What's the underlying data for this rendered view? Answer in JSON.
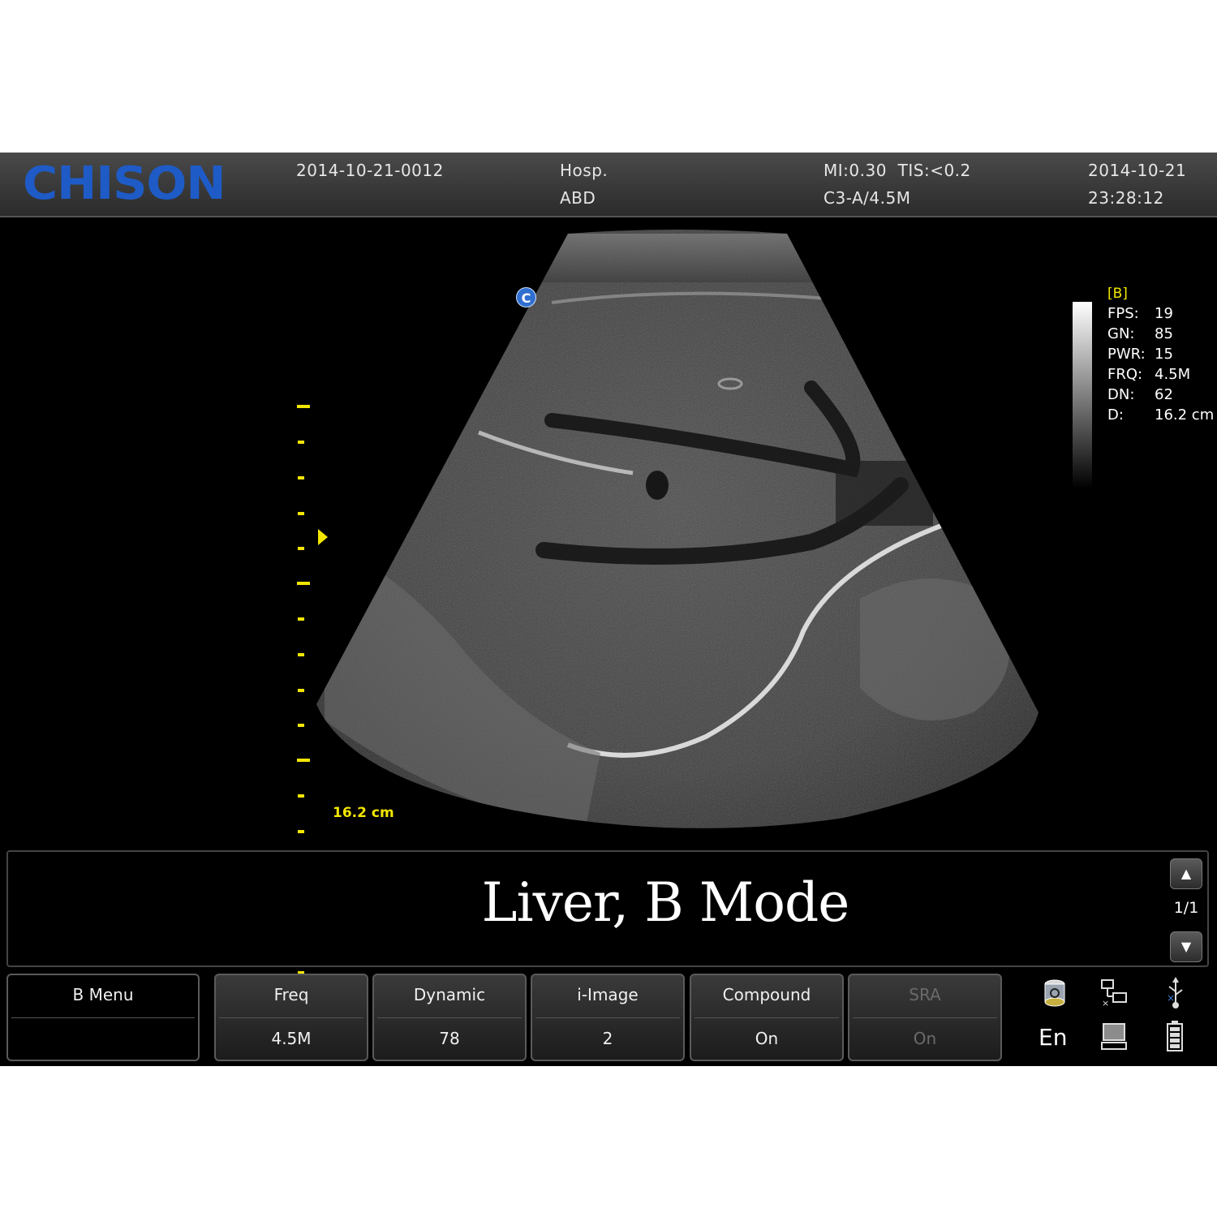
{
  "header": {
    "logo": "CHISON",
    "patient_id": "2014-10-21-0012",
    "hospital": "Hosp.",
    "exam": "ABD",
    "mi_tis": "MI:0.30  TIS:<0.2",
    "probe": "C3-A/4.5M",
    "date": "2014-10-21",
    "time": "23:28:12"
  },
  "image": {
    "orientation_marker": "C",
    "depth_label": "16.2 cm",
    "mode": "[B]",
    "params": [
      {
        "key": "FPS:",
        "value": "19"
      },
      {
        "key": "GN:",
        "value": "85"
      },
      {
        "key": "PWR:",
        "value": "15"
      },
      {
        "key": "FRQ:",
        "value": "4.5M"
      },
      {
        "key": "DN:",
        "value": "62"
      },
      {
        "key": "D:",
        "value": "16.2 cm"
      }
    ]
  },
  "comment": {
    "text": "Liver, B Mode",
    "page": "1/1",
    "up_icon": "triangle-up-icon",
    "down_icon": "triangle-down-icon"
  },
  "menu": {
    "label": "B Menu",
    "buttons": [
      {
        "label": "Freq",
        "value": "4.5M",
        "enabled": true
      },
      {
        "label": "Dynamic",
        "value": "78",
        "enabled": true
      },
      {
        "label": "i-Image",
        "value": "2",
        "enabled": true
      },
      {
        "label": "Compound",
        "value": "On",
        "enabled": true
      },
      {
        "label": "SRA",
        "value": "On",
        "enabled": false
      }
    ]
  },
  "status": {
    "language": "En",
    "icons": [
      "disk-icon",
      "network-icon",
      "usb-icon",
      "computer-icon",
      "battery-icon"
    ]
  }
}
